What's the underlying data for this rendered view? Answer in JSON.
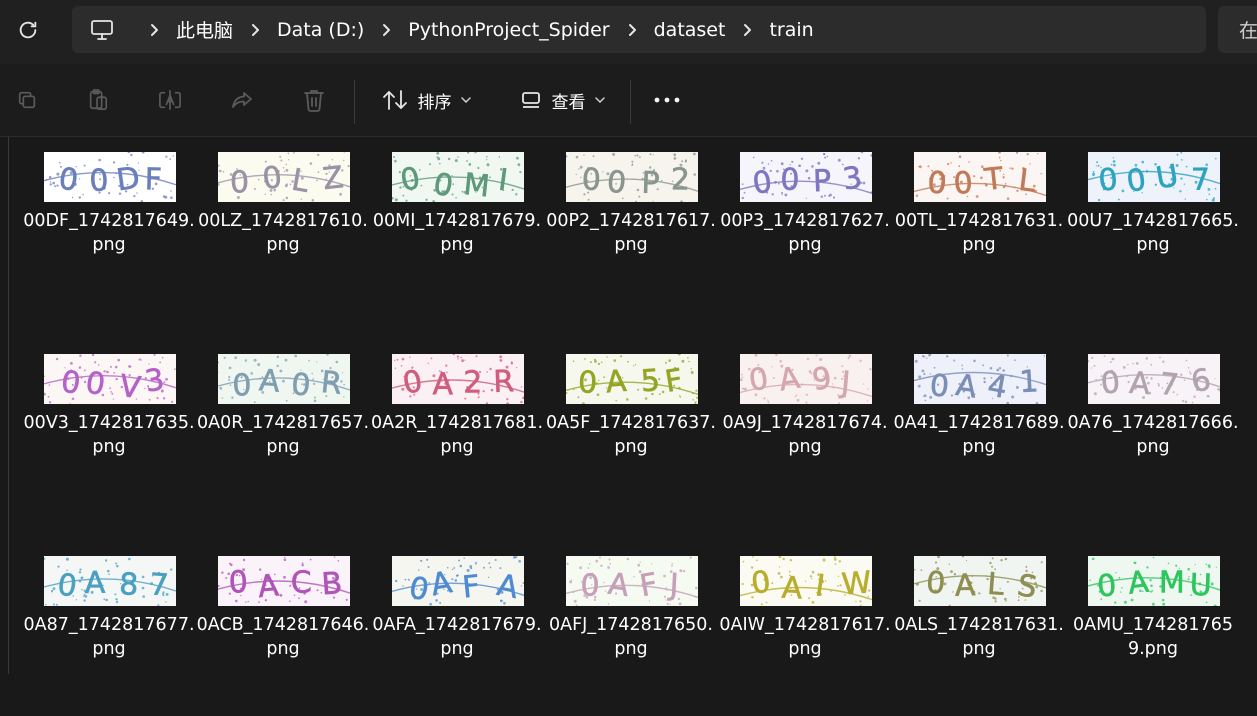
{
  "breadcrumb": {
    "items": [
      "此电脑",
      "Data (D:)",
      "PythonProject_Spider",
      "dataset",
      "train"
    ],
    "root_icon": "computer-icon"
  },
  "search": {
    "placeholder": "在 train 中搜索"
  },
  "toolbar": {
    "sort_label": "排序",
    "view_label": "查看"
  },
  "files": [
    {
      "name": "00DF_1742817649.png",
      "captcha": "00DF",
      "color": "#6b7fbe",
      "bg": "#ffffff"
    },
    {
      "name": "00LZ_1742817610.png",
      "captcha": "00LZ",
      "color": "#9a93a6",
      "bg": "#fcfbf0"
    },
    {
      "name": "00MI_1742817679.png",
      "captcha": "00MI",
      "color": "#5e9a7a",
      "bg": "#f1f8f2"
    },
    {
      "name": "00P2_1742817617.png",
      "captcha": "00P2",
      "color": "#8b9590",
      "bg": "#f7f4ee"
    },
    {
      "name": "00P3_1742817627.png",
      "captcha": "00P3",
      "color": "#7f76c2",
      "bg": "#f5f5fb"
    },
    {
      "name": "00TL_1742817631.png",
      "captcha": "00TL",
      "color": "#c07a57",
      "bg": "#fbf6f4"
    },
    {
      "name": "00U7_1742817665.png",
      "captcha": "00U7",
      "color": "#2ea3bf",
      "bg": "#eef2fb"
    },
    {
      "name": "00V3_1742817635.png",
      "captcha": "00V3",
      "color": "#b462c9",
      "bg": "#fcf7f4"
    },
    {
      "name": "0A0R_1742817657.png",
      "captcha": "0A0R",
      "color": "#7f9fb0",
      "bg": "#f0f7f1"
    },
    {
      "name": "0A2R_1742817681.png",
      "captcha": "0A2R",
      "color": "#d05c7e",
      "bg": "#fbf0f3"
    },
    {
      "name": "0A5F_1742817637.png",
      "captcha": "0A5F",
      "color": "#94a524",
      "bg": "#f6f8ee"
    },
    {
      "name": "0A9J_1742817674.png",
      "captcha": "0A9J",
      "color": "#d4a6b0",
      "bg": "#f9f1ef"
    },
    {
      "name": "0A41_1742817689.png",
      "captcha": "0A41",
      "color": "#7b8eb8",
      "bg": "#eef1f9"
    },
    {
      "name": "0A76_1742817666.png",
      "captcha": "0A76",
      "color": "#b2a3b0",
      "bg": "#f8f3f7"
    },
    {
      "name": "0A87_1742817677.png",
      "captcha": "0A87",
      "color": "#4ba0c2",
      "bg": "#f4f7f5"
    },
    {
      "name": "0ACB_1742817646.png",
      "captcha": "0ACB",
      "color": "#b054b8",
      "bg": "#faf3fa"
    },
    {
      "name": "0AFA_1742817679.png",
      "captcha": "0AFA",
      "color": "#4f8bd0",
      "bg": "#f6f6f0"
    },
    {
      "name": "0AFJ_1742817650.png",
      "captcha": "0AFJ",
      "color": "#c6a0b9",
      "bg": "#f6fbf2"
    },
    {
      "name": "0AIW_1742817617.png",
      "captcha": "0AIW",
      "color": "#b9ad2e",
      "bg": "#fbfbf3"
    },
    {
      "name": "0ALS_1742817631.png",
      "captcha": "0ALS",
      "color": "#8f8e52",
      "bg": "#f1f5f1"
    },
    {
      "name": "0AMU_1742817659.png",
      "captcha": "0AMU",
      "color": "#2fc55e",
      "bg": "#eef8f0"
    }
  ]
}
